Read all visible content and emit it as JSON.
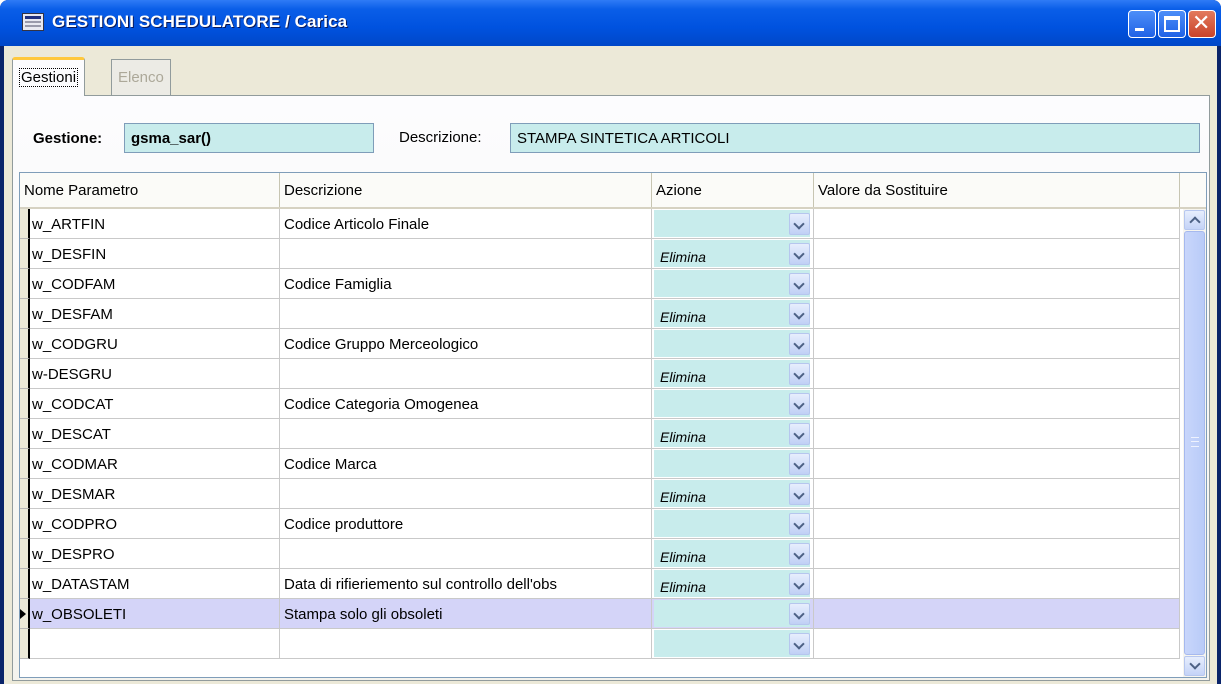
{
  "window": {
    "title": "GESTIONI SCHEDULATORE / Carica",
    "controls": [
      "minimize-icon",
      "maximize-icon",
      "close-icon"
    ]
  },
  "tabs": [
    {
      "label": "Gestioni",
      "active": true
    },
    {
      "label": "Elenco",
      "active": false
    }
  ],
  "form": {
    "gestione_label": "Gestione:",
    "gestione_value": "gsma_sar()",
    "descrizione_label": "Descrizione:",
    "descrizione_value": "STAMPA SINTETICA ARTICOLI"
  },
  "grid": {
    "columns": [
      "Nome Parametro",
      "Descrizione",
      "Azione",
      "Valore da Sostituire"
    ],
    "rows": [
      {
        "nome": "w_ARTFIN",
        "descrizione": "Codice Articolo Finale",
        "azione": "",
        "valore": ""
      },
      {
        "nome": "w_DESFIN",
        "descrizione": "",
        "azione": "Elimina",
        "valore": ""
      },
      {
        "nome": "w_CODFAM",
        "descrizione": "Codice Famiglia",
        "azione": "",
        "valore": ""
      },
      {
        "nome": "w_DESFAM",
        "descrizione": "",
        "azione": "Elimina",
        "valore": ""
      },
      {
        "nome": "w_CODGRU",
        "descrizione": "Codice Gruppo Merceologico",
        "azione": "",
        "valore": ""
      },
      {
        "nome": "w-DESGRU",
        "descrizione": "",
        "azione": "Elimina",
        "valore": ""
      },
      {
        "nome": "w_CODCAT",
        "descrizione": "Codice Categoria Omogenea",
        "azione": "",
        "valore": ""
      },
      {
        "nome": "w_DESCAT",
        "descrizione": "",
        "azione": "Elimina",
        "valore": ""
      },
      {
        "nome": "w_CODMAR",
        "descrizione": "Codice Marca",
        "azione": "",
        "valore": ""
      },
      {
        "nome": "w_DESMAR",
        "descrizione": "",
        "azione": "Elimina",
        "valore": ""
      },
      {
        "nome": "w_CODPRO",
        "descrizione": "Codice produttore",
        "azione": "",
        "valore": ""
      },
      {
        "nome": "w_DESPRO",
        "descrizione": "",
        "azione": "Elimina",
        "valore": ""
      },
      {
        "nome": "w_DATASTAM",
        "descrizione": "Data di rifieriemento sul controllo dell'obs",
        "azione": "Elimina",
        "valore": ""
      },
      {
        "nome": "w_OBSOLETI",
        "descrizione": "Stampa solo gli obsoleti",
        "azione": "",
        "valore": "",
        "selected": true
      },
      {
        "nome": "",
        "descrizione": "",
        "azione": "",
        "valore": ""
      }
    ]
  },
  "colors": {
    "titlebar": "#0052df",
    "field_bg": "#c8ecec",
    "selected_row": "#d4d4f8",
    "client_bg": "#ece9d8"
  }
}
